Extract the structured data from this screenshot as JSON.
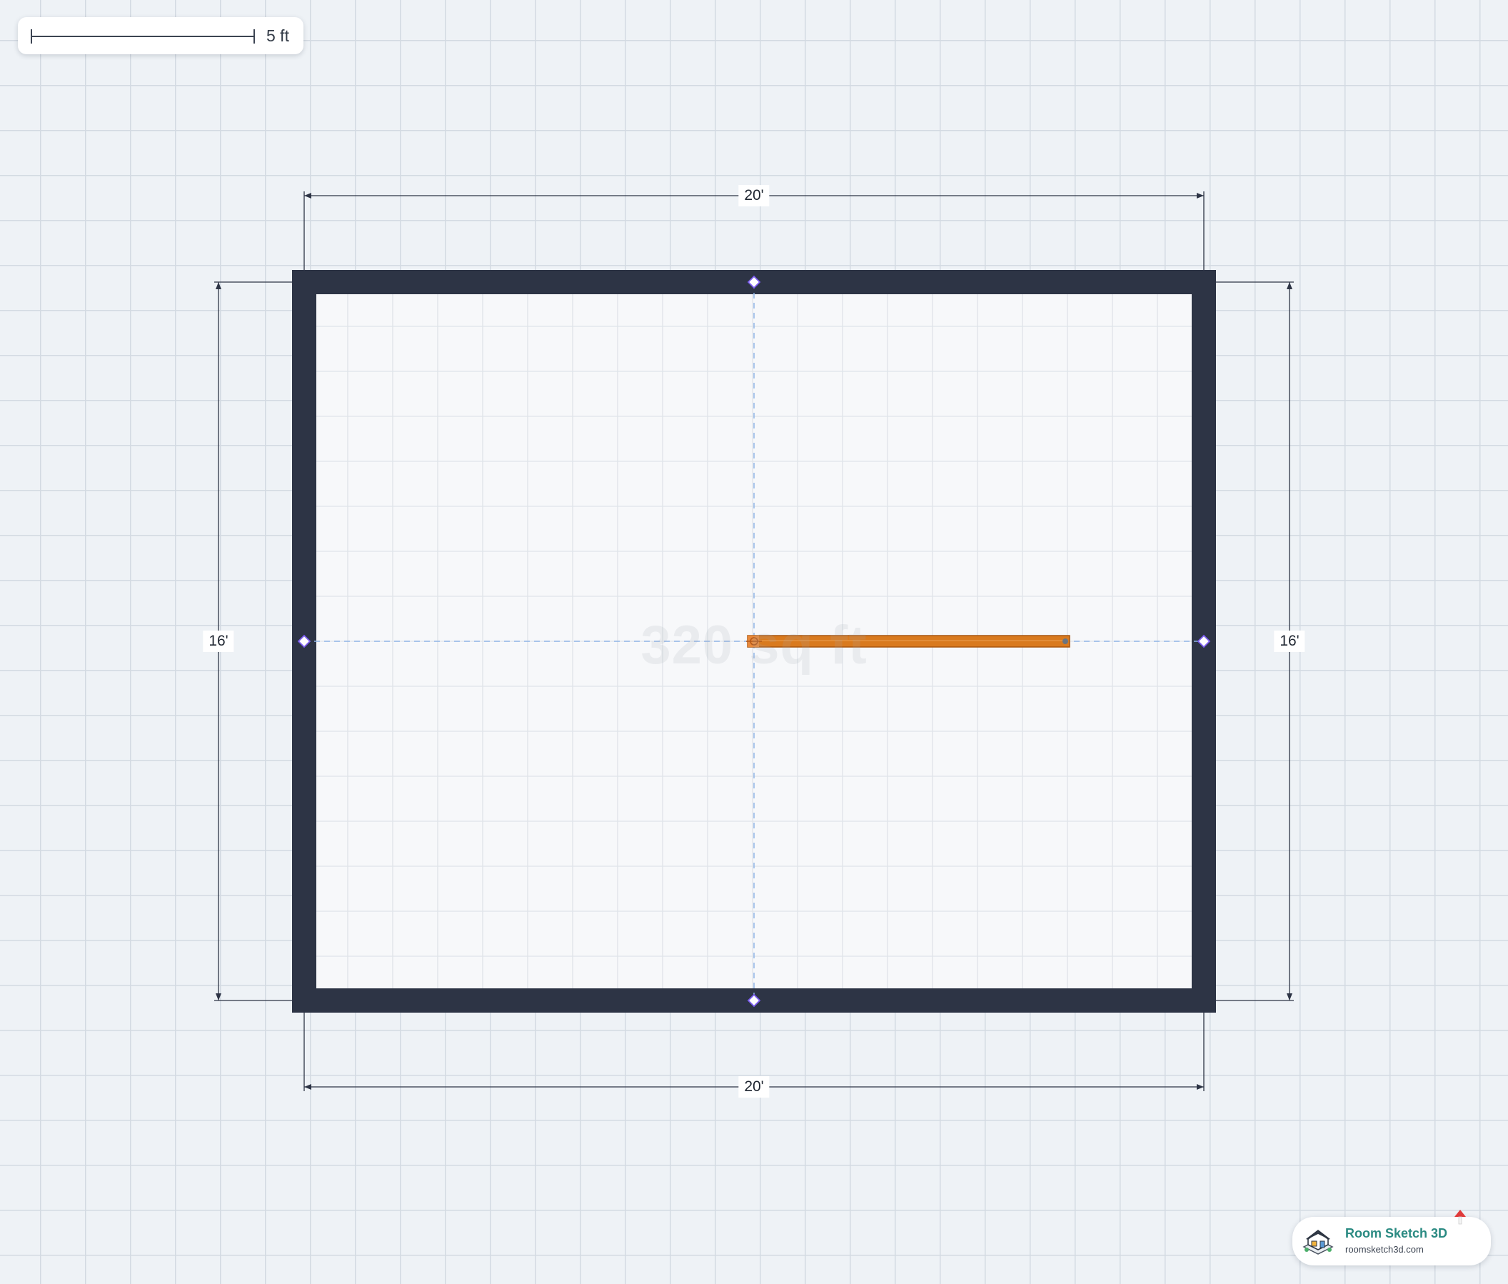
{
  "scale": {
    "label": "5 ft"
  },
  "room": {
    "area_label": "320 sq ft",
    "dimensions": {
      "top": "20'",
      "bottom": "20'",
      "left": "16'",
      "right": "16'"
    }
  },
  "branding": {
    "title": "Room Sketch 3D",
    "url": "roomsketch3d.com"
  },
  "colors": {
    "wall": "#2d3445",
    "selected_wall": "#d97a1e",
    "guide": "#8fb4e6",
    "handle": "#7b5cf0",
    "brand": "#2a8a82"
  }
}
